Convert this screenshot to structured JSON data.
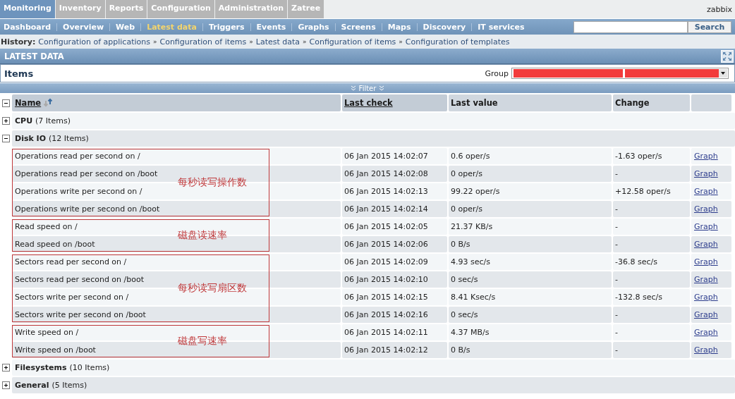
{
  "top_menu": [
    {
      "label": "Monitoring",
      "selected": true
    },
    {
      "label": "Inventory",
      "selected": false
    },
    {
      "label": "Reports",
      "selected": false
    },
    {
      "label": "Configuration",
      "selected": false
    },
    {
      "label": "Administration",
      "selected": false
    },
    {
      "label": "Zatree",
      "selected": false
    }
  ],
  "user": "zabbix",
  "sub_menu": [
    {
      "label": "Dashboard",
      "selected": false
    },
    {
      "label": "Overview",
      "selected": false
    },
    {
      "label": "Web",
      "selected": false
    },
    {
      "label": "Latest data",
      "selected": true
    },
    {
      "label": "Triggers",
      "selected": false
    },
    {
      "label": "Events",
      "selected": false
    },
    {
      "label": "Graphs",
      "selected": false
    },
    {
      "label": "Screens",
      "selected": false
    },
    {
      "label": "Maps",
      "selected": false
    },
    {
      "label": "Discovery",
      "selected": false
    },
    {
      "label": "IT services",
      "selected": false
    }
  ],
  "search": {
    "button": "Search"
  },
  "history": {
    "label": "History:",
    "separator": "»",
    "links": [
      "Configuration of applications",
      "Configuration of items",
      "Latest data",
      "Configuration of items",
      "Configuration of templates"
    ]
  },
  "section_title": "LATEST DATA",
  "items_panel": {
    "title": "Items",
    "group_label": "Group",
    "group_redacted": true
  },
  "filter": {
    "label": "Filter"
  },
  "table": {
    "toggle_all": {
      "expanded": true
    },
    "columns": [
      {
        "label": "Name",
        "link": true,
        "sorted": true
      },
      {
        "label": "Last check",
        "link": true,
        "sorted": false
      },
      {
        "label": "Last value",
        "link": false,
        "sorted": false
      },
      {
        "label": "Change",
        "link": false,
        "sorted": false
      }
    ],
    "groups": [
      {
        "name": "CPU",
        "count": "(7 Items)",
        "expanded": false
      },
      {
        "name": "Disk IO",
        "count": "(12 Items)",
        "expanded": true,
        "blocks": [
          {
            "note": "每秒读写操作数",
            "rows": [
              {
                "name": "Operations read per second on /",
                "last_check": "06 Jan 2015 14:02:07",
                "last_value": "0.6 oper/s",
                "change": "-1.63 oper/s",
                "link": "Graph"
              },
              {
                "name": "Operations read per second on /boot",
                "last_check": "06 Jan 2015 14:02:08",
                "last_value": "0 oper/s",
                "change": "-",
                "link": "Graph"
              },
              {
                "name": "Operations write per second on /",
                "last_check": "06 Jan 2015 14:02:13",
                "last_value": "99.22 oper/s",
                "change": "+12.58 oper/s",
                "link": "Graph"
              },
              {
                "name": "Operations write per second on /boot",
                "last_check": "06 Jan 2015 14:02:14",
                "last_value": "0 oper/s",
                "change": "-",
                "link": "Graph"
              }
            ]
          },
          {
            "note": "磁盘读速率",
            "rows": [
              {
                "name": "Read speed on /",
                "last_check": "06 Jan 2015 14:02:05",
                "last_value": "21.37 KB/s",
                "change": "-",
                "link": "Graph"
              },
              {
                "name": "Read speed on /boot",
                "last_check": "06 Jan 2015 14:02:06",
                "last_value": "0 B/s",
                "change": "-",
                "link": "Graph"
              }
            ]
          },
          {
            "note": "每秒读写扇区数",
            "rows": [
              {
                "name": "Sectors read per second on /",
                "last_check": "06 Jan 2015 14:02:09",
                "last_value": "4.93 sec/s",
                "change": "-36.8 sec/s",
                "link": "Graph"
              },
              {
                "name": "Sectors read per second on /boot",
                "last_check": "06 Jan 2015 14:02:10",
                "last_value": "0 sec/s",
                "change": "-",
                "link": "Graph"
              },
              {
                "name": "Sectors write per second on /",
                "last_check": "06 Jan 2015 14:02:15",
                "last_value": "8.41 Ksec/s",
                "change": "-132.8 sec/s",
                "link": "Graph"
              },
              {
                "name": "Sectors write per second on /boot",
                "last_check": "06 Jan 2015 14:02:16",
                "last_value": "0 sec/s",
                "change": "-",
                "link": "Graph"
              }
            ]
          },
          {
            "note": "磁盘写速率",
            "rows": [
              {
                "name": "Write speed on /",
                "last_check": "06 Jan 2015 14:02:11",
                "last_value": "4.37 MB/s",
                "change": "-",
                "link": "Graph"
              },
              {
                "name": "Write speed on /boot",
                "last_check": "06 Jan 2015 14:02:12",
                "last_value": "0 B/s",
                "change": "-",
                "link": "Graph"
              }
            ]
          }
        ]
      },
      {
        "name": "Filesystems",
        "count": "(10 Items)",
        "expanded": false
      },
      {
        "name": "General",
        "count": "(5 Items)",
        "expanded": false
      }
    ]
  }
}
